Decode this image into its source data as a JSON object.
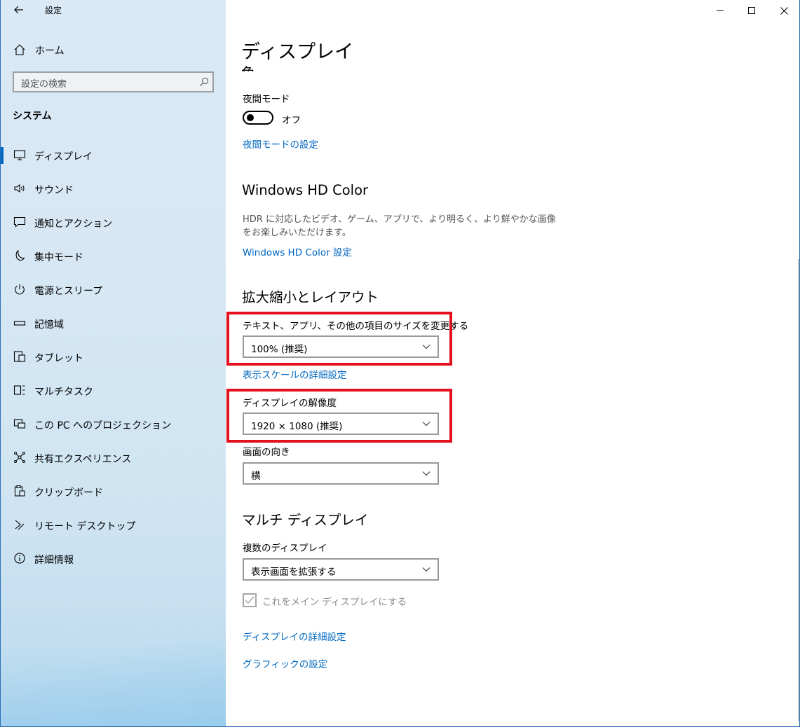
{
  "app": {
    "title": "設定"
  },
  "sidebar": {
    "home_label": "ホーム",
    "search_placeholder": "設定の検索",
    "section": "システム",
    "items": [
      {
        "label": "ディスプレイ",
        "icon": "monitor-icon",
        "active": true
      },
      {
        "label": "サウンド",
        "icon": "speaker-icon"
      },
      {
        "label": "通知とアクション",
        "icon": "notification-icon"
      },
      {
        "label": "集中モード",
        "icon": "moon-icon"
      },
      {
        "label": "電源とスリープ",
        "icon": "power-icon"
      },
      {
        "label": "記憶域",
        "icon": "storage-icon"
      },
      {
        "label": "タブレット",
        "icon": "tablet-icon"
      },
      {
        "label": "マルチタスク",
        "icon": "multitask-icon"
      },
      {
        "label": "この PC へのプロジェクション",
        "icon": "projection-icon"
      },
      {
        "label": "共有エクスペリエンス",
        "icon": "share-icon"
      },
      {
        "label": "クリップボード",
        "icon": "clipboard-icon"
      },
      {
        "label": "リモート デスクトップ",
        "icon": "remote-desktop-icon"
      },
      {
        "label": "詳細情報",
        "icon": "info-icon"
      }
    ]
  },
  "main": {
    "page_title": "ディスプレイ",
    "partial_heading": "色",
    "night_mode": {
      "label": "夜間モード",
      "state_text": "オフ",
      "settings_link": "夜間モードの設定"
    },
    "hdr": {
      "heading": "Windows HD Color",
      "description": "HDR に対応したビデオ、ゲーム、アプリで、より明るく、より鮮やかな画像をお楽しみいただけます。",
      "link": "Windows HD Color 設定"
    },
    "scale_layout": {
      "heading": "拡大縮小とレイアウト",
      "text_size_label": "テキスト、アプリ、その他の項目のサイズを変更する",
      "text_size_value": "100% (推奨)",
      "advanced_scale_link": "表示スケールの詳細設定",
      "resolution_label": "ディスプレイの解像度",
      "resolution_value": "1920 × 1080 (推奨)",
      "orientation_label": "画面の向き",
      "orientation_value": "横"
    },
    "multi_display": {
      "heading": "マルチ ディスプレイ",
      "label": "複数のディスプレイ",
      "value": "表示画面を拡張する",
      "main_display_checkbox": "これをメイン ディスプレイにする",
      "advanced_link": "ディスプレイの詳細設定",
      "graphics_link": "グラフィックの設定"
    }
  },
  "colors": {
    "accent": "#0067c0",
    "highlight": "#e3101e"
  }
}
